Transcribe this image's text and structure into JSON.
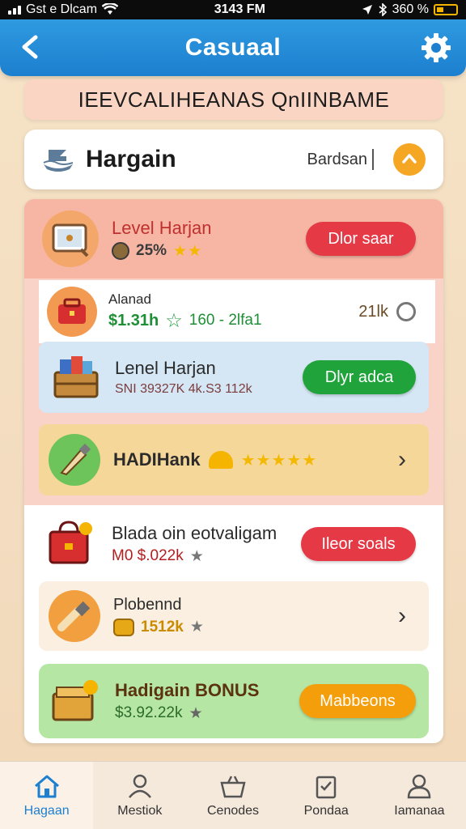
{
  "status_bar": {
    "carrier": "Gst e Dlcam",
    "time": "3143 FM",
    "battery": "360 %"
  },
  "header": {
    "title": "Casuaal"
  },
  "banner": {
    "text": "IEEVCALIHEANAS QnIINBAME"
  },
  "search": {
    "name": "Hargain",
    "placeholder": "Bardsan"
  },
  "items": [
    {
      "title": "Level Harjan",
      "detail": "25%",
      "stars": "★★",
      "button": "Dlor saar"
    },
    {
      "title": "Alanad",
      "price": "$1.31h",
      "extra": "160 - 2lfa1",
      "value": "21lk"
    },
    {
      "title": "Lenel Harjan",
      "detail": "SNI 39327K 4k.S3 112k",
      "button": "Dlyr adca"
    },
    {
      "title": "HADIHank",
      "stars": "★★★★★"
    },
    {
      "title": "Blada oin eotvaligam",
      "detail": "M0 $.022k",
      "stars": "★",
      "button": "Ileor soals"
    },
    {
      "title": "Plobennd",
      "detail": "1512k",
      "stars": "★"
    },
    {
      "title": "Hadigain BONUS",
      "detail": "$3.92.22k",
      "stars": "★",
      "button": "Mabbeons"
    }
  ],
  "tabs": [
    {
      "label": "Hagaan"
    },
    {
      "label": "Mestiok"
    },
    {
      "label": "Cenodes"
    },
    {
      "label": "Pondaa"
    },
    {
      "label": "Iamanaa"
    }
  ],
  "colors": {
    "header": "#1c7fcf",
    "red_button": "#e63946",
    "green_button": "#1fa33a",
    "orange_button": "#f59e0b",
    "star": "#f5b800"
  }
}
